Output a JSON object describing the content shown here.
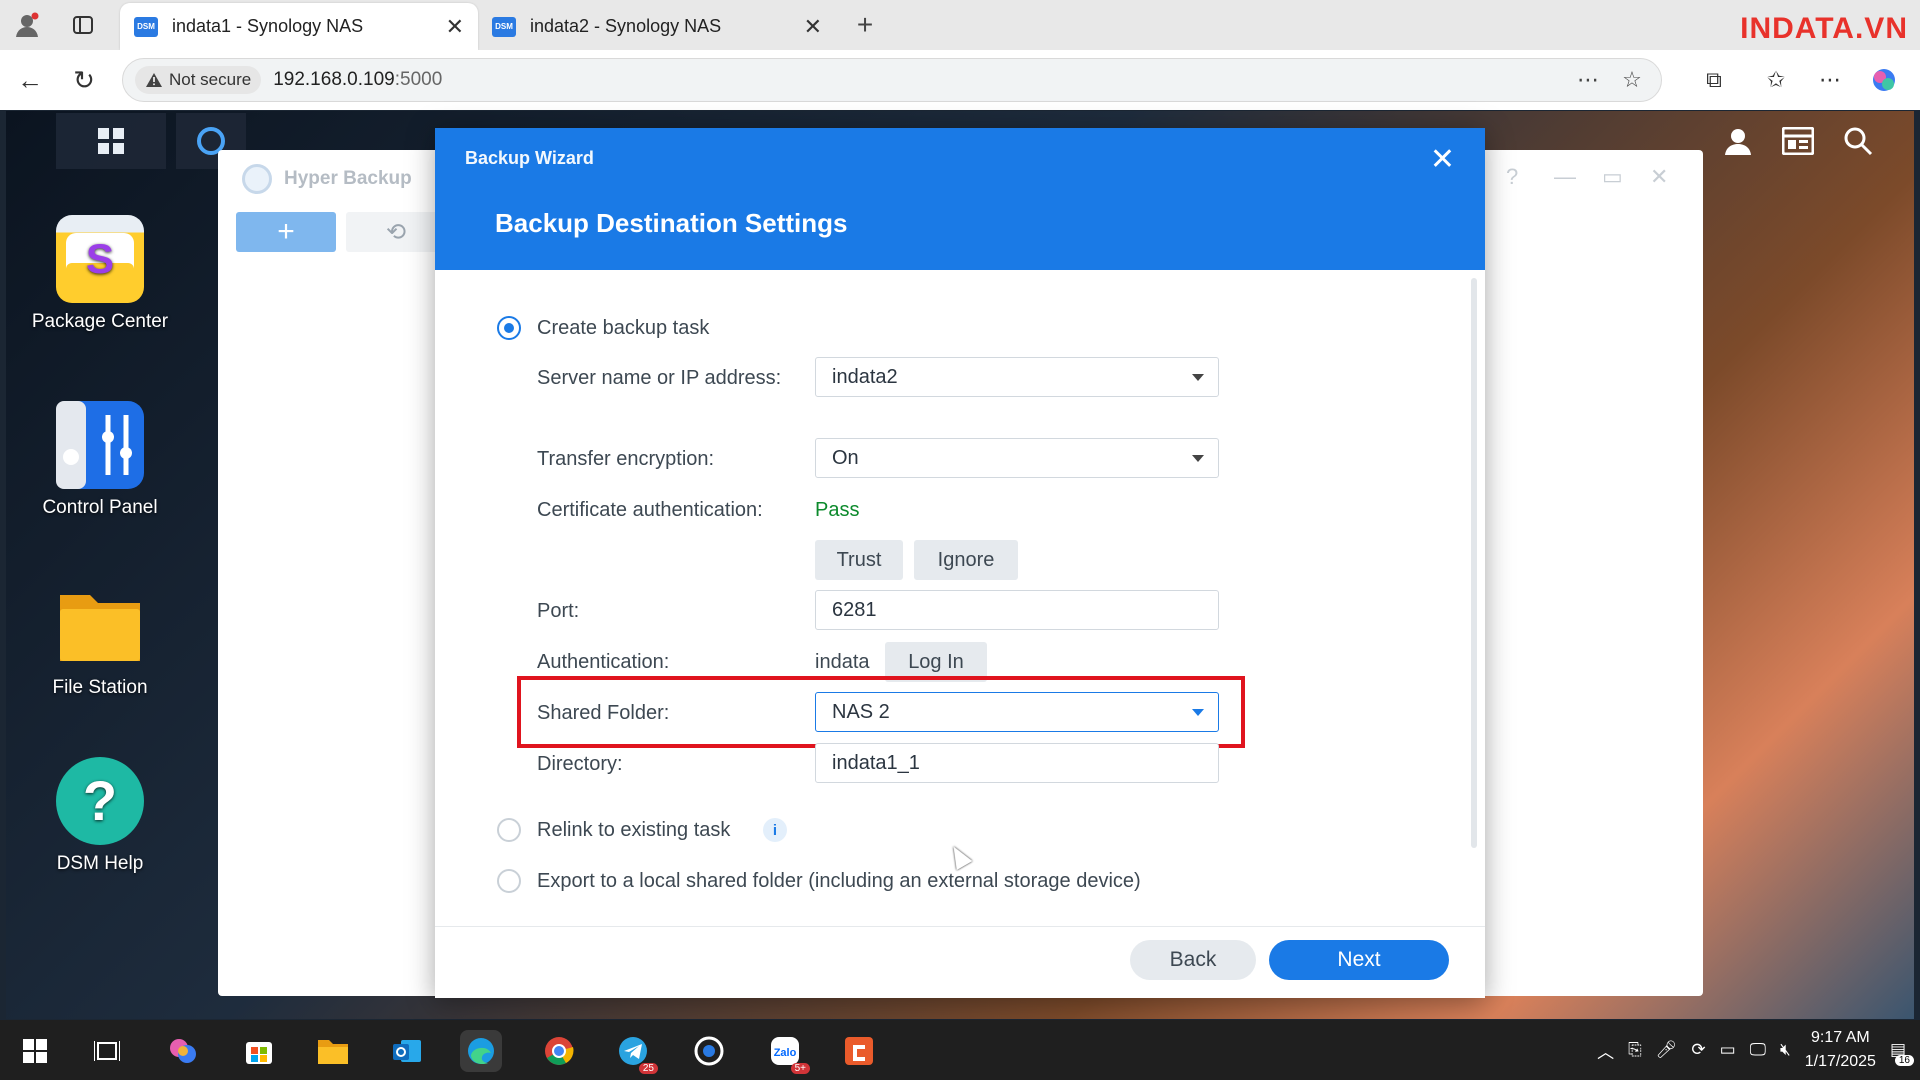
{
  "browser": {
    "tabs": [
      {
        "title": "indata1 - Synology NAS",
        "favicon": "DSM"
      },
      {
        "title": "indata2 - Synology NAS",
        "favicon": "DSM"
      }
    ],
    "watermark": "INDATA.VN",
    "security_label": "Not secure",
    "url_host": "192.168.0.109",
    "url_port": ":5000"
  },
  "desktop": {
    "icons": [
      {
        "label": "Package Center",
        "icon": "package-center-icon",
        "color": "#ffcd2d"
      },
      {
        "label": "Control Panel",
        "icon": "control-panel-icon",
        "color": "#1e6ee6"
      },
      {
        "label": "File Station",
        "icon": "file-station-icon",
        "color": "#f6b522"
      },
      {
        "label": "DSM Help",
        "icon": "dsm-help-icon",
        "color": "#1eb9a4"
      }
    ]
  },
  "hyper_backup": {
    "title": "Hyper Backup"
  },
  "wizard": {
    "title": "Backup Wizard",
    "subtitle": "Backup Destination Settings",
    "option_create": "Create backup task",
    "server_label": "Server name or IP address:",
    "server_value": "indata2",
    "encryption_label": "Transfer encryption:",
    "encryption_value": "On",
    "cert_label": "Certificate authentication:",
    "cert_value": "Pass",
    "trust_label": "Trust",
    "ignore_label": "Ignore",
    "port_label": "Port:",
    "port_value": "6281",
    "auth_label": "Authentication:",
    "auth_user": "indata",
    "login_label": "Log In",
    "shared_folder_label": "Shared Folder:",
    "shared_folder_value": "NAS 2",
    "directory_label": "Directory:",
    "directory_value": "indata1_1",
    "option_relink": "Relink to existing task",
    "option_export": "Export to a local shared folder (including an external storage device)",
    "back_label": "Back",
    "next_label": "Next",
    "accent_color": "#1a7ae6",
    "selected_option": "create"
  },
  "taskbar": {
    "telegram_badge": "25",
    "zalo_badge": "5+",
    "time": "9:17 AM",
    "date": "1/17/2025",
    "notifications": "16"
  }
}
